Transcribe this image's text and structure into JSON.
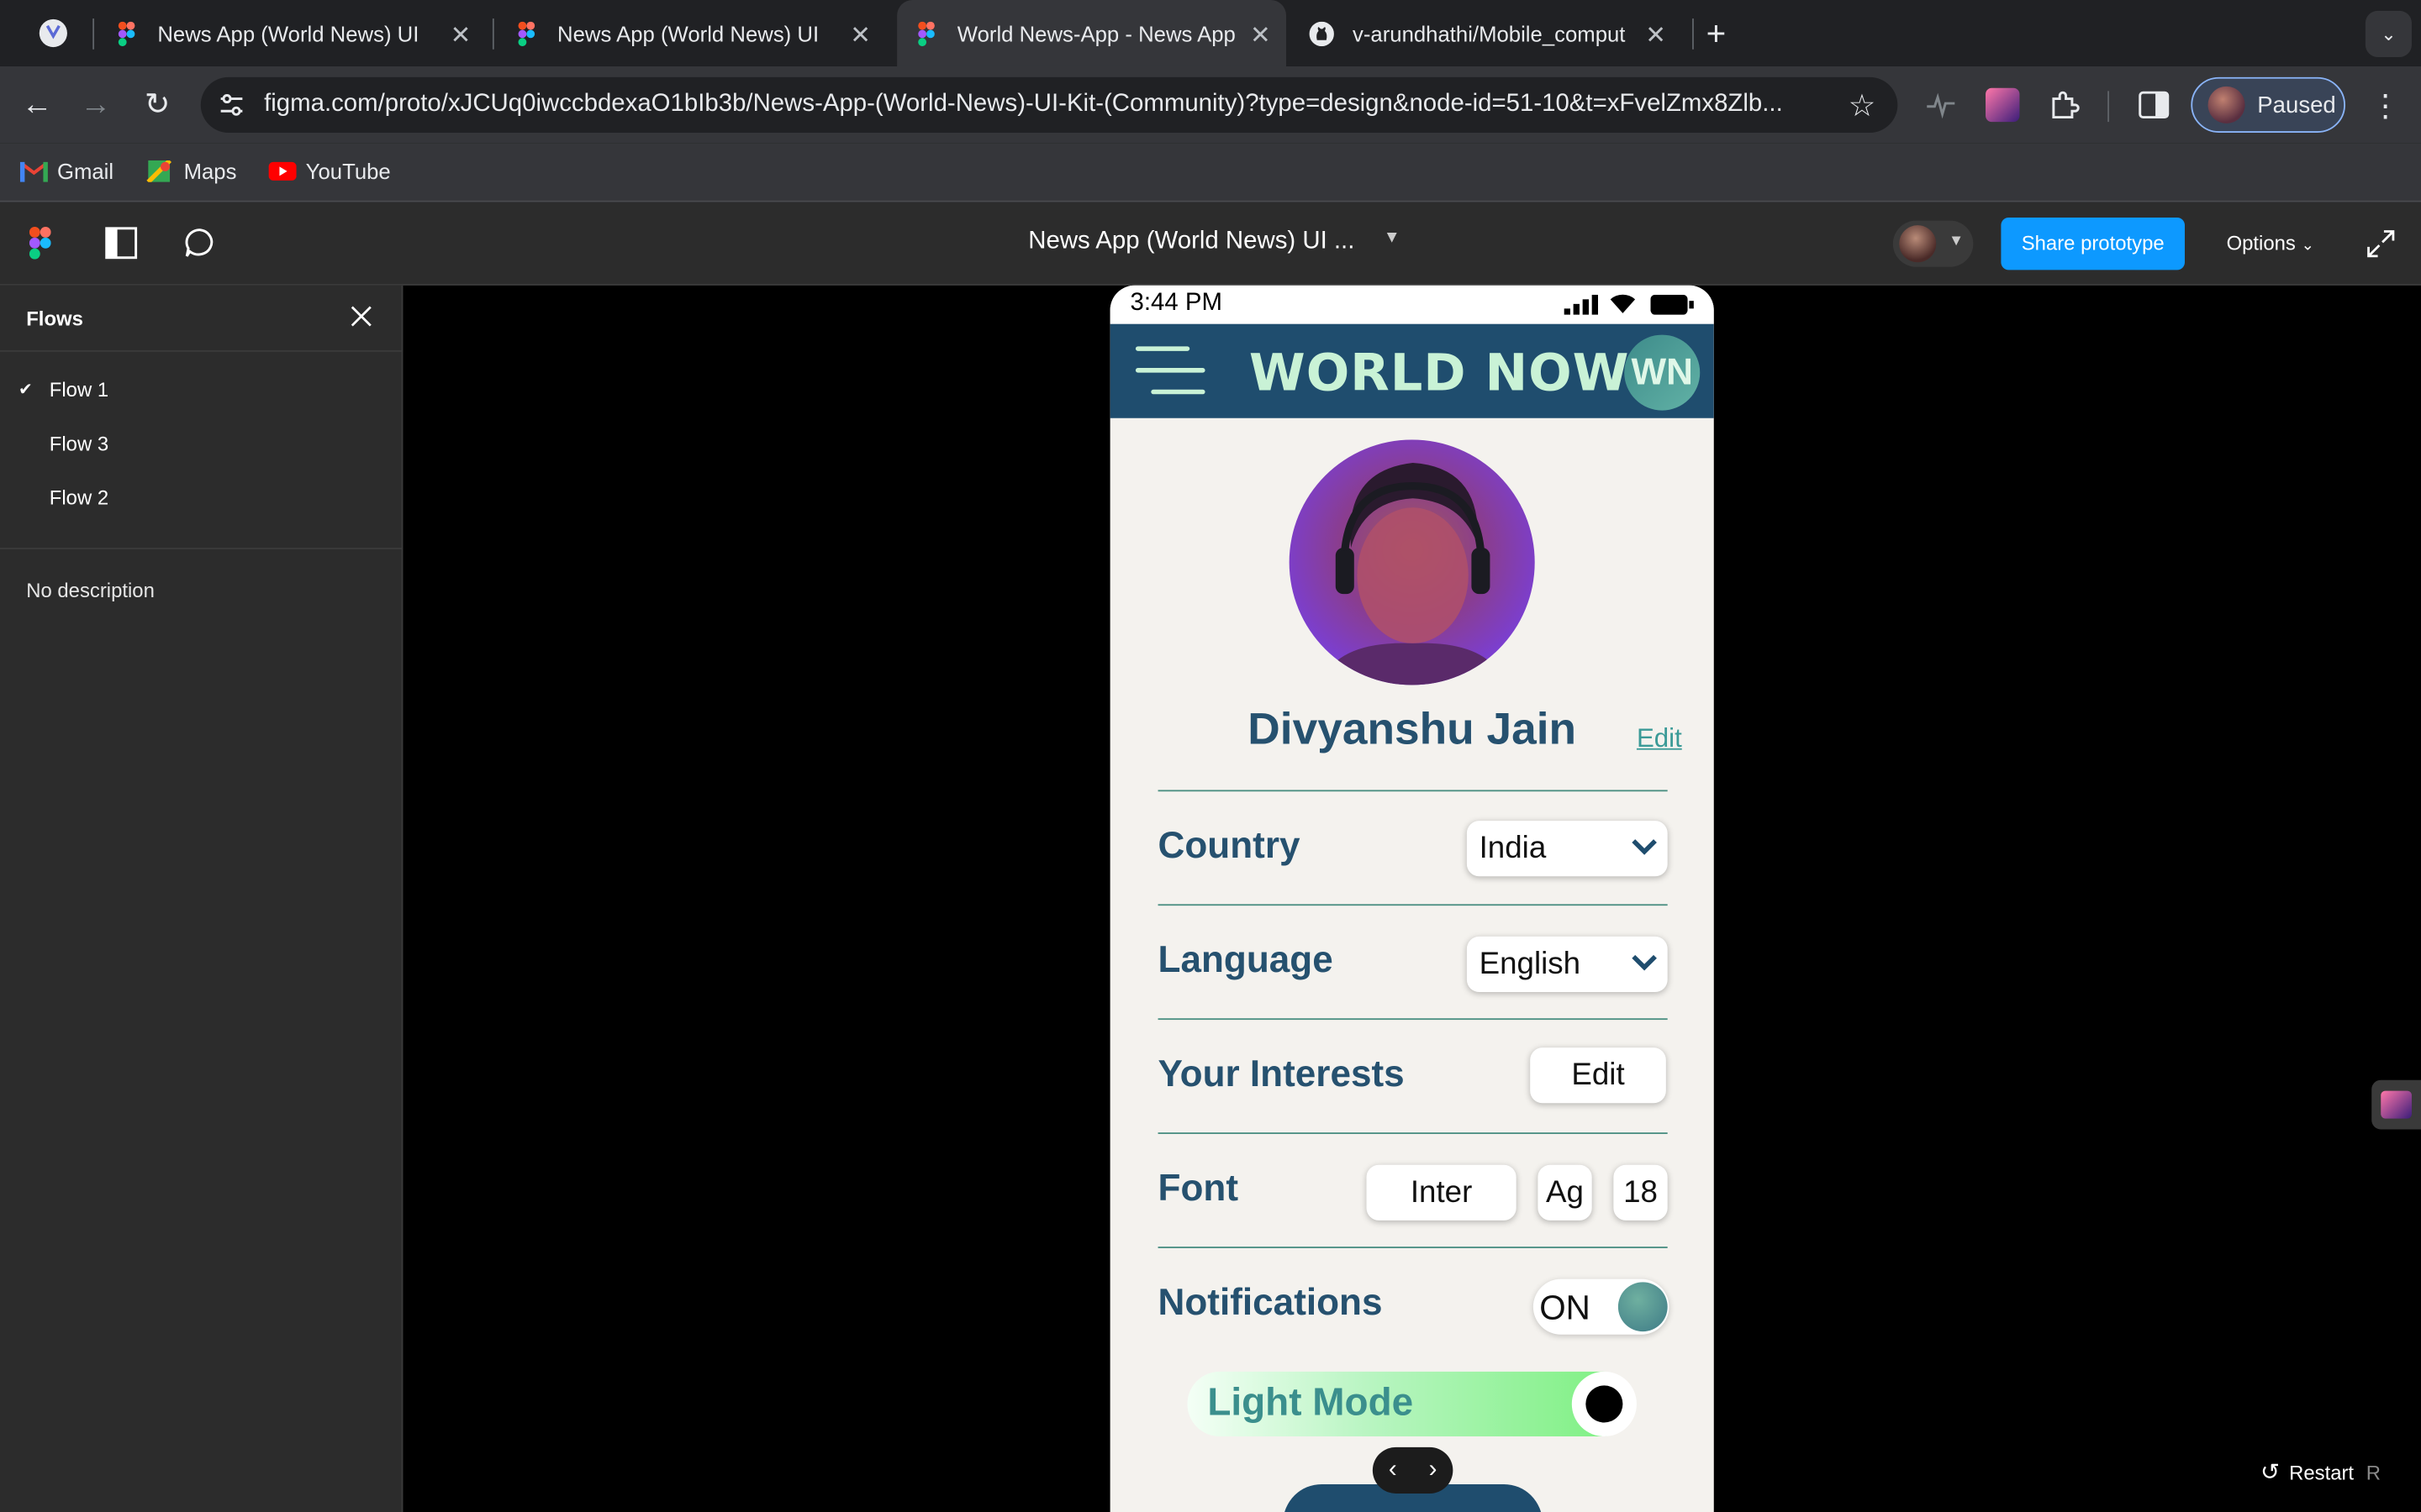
{
  "browser": {
    "tabs": [
      {
        "title": "News App (World News) UI Ki",
        "active": false
      },
      {
        "title": "News App (World News) UI Ki",
        "active": false
      },
      {
        "title": "World News-App - News App",
        "active": true
      },
      {
        "title": "v-arundhathi/Mobile_comput",
        "active": false
      }
    ],
    "url": "figma.com/proto/xJCUq0iwccbdexaO1bIb3b/News-App-(World-News)-UI-Kit-(Community)?type=design&node-id=51-10&t=xFvelZmx8Zlb...",
    "profile_label": "Paused",
    "bookmarks": [
      "Gmail",
      "Maps",
      "YouTube"
    ]
  },
  "figma": {
    "file_title": "News App (World News) UI ...",
    "share_label": "Share prototype",
    "options_label": "Options",
    "restart_label": "Restart",
    "restart_key": "R"
  },
  "sidebar": {
    "title": "Flows",
    "flows": [
      "Flow 1",
      "Flow 3",
      "Flow 2"
    ],
    "selected_flow": "Flow 1",
    "description": "No description"
  },
  "phone": {
    "time": "3:44 PM",
    "brand": "WORLD NOW",
    "logo": "WN",
    "user_name": "Divyanshu Jain",
    "edit_link": "Edit",
    "country_label": "Country",
    "country_value": "India",
    "language_label": "Language",
    "language_value": "English",
    "interests_label": "Your Interests",
    "interests_button": "Edit",
    "font_label": "Font",
    "font_family": "Inter",
    "font_sample": "Ag",
    "font_size": "18",
    "notifications_label": "Notifications",
    "notifications_state": "ON",
    "mode_label": "Light Mode"
  },
  "colors": {
    "figma_blue": "#0d99ff",
    "app_navy": "#1f4d6e",
    "brand_mint": "#c9f2d6",
    "teal": "#3a9a97"
  }
}
